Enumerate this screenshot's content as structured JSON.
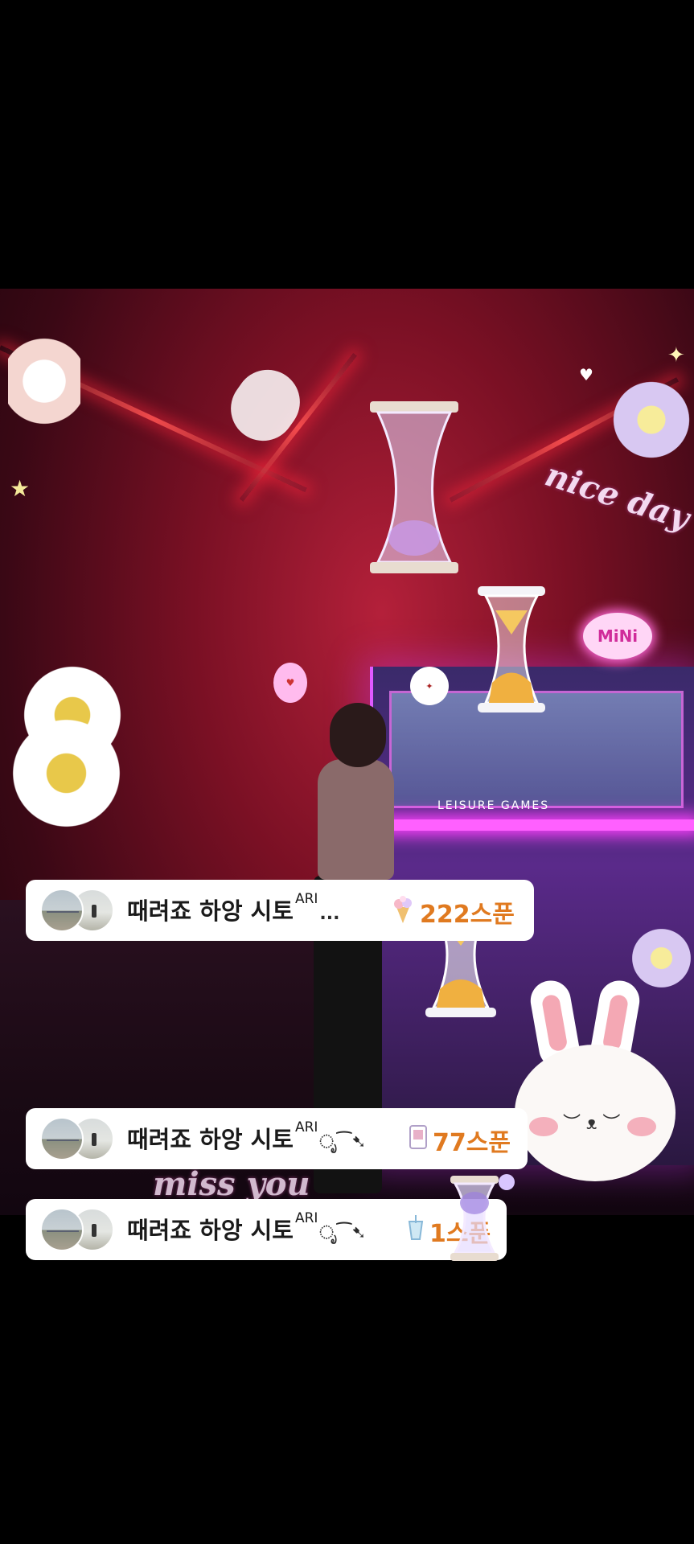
{
  "stream": {
    "background_scene": "arcade claw machines",
    "stickers": {
      "nice_day_text": "nice day",
      "miss_you_text": "miss you",
      "mini_sign": "MiNi",
      "leisure_games_label": "LEISURE GAMES"
    }
  },
  "donations": [
    {
      "username": "때려죠 하앙 시토",
      "superscript": "ARI",
      "suffix": "...",
      "gift_icon": "flower-bouquet-icon",
      "amount": "222스푼"
    },
    {
      "username": "때려죠 하앙 시토",
      "superscript": "ARI",
      "suffix": "ೃ⁀➷",
      "gift_icon": "photo-card-icon",
      "amount": "77스푼"
    },
    {
      "username": "때려죠 하앙 시토",
      "superscript": "ARI",
      "suffix": "ೃ⁀➷",
      "gift_icon": "drink-cup-icon",
      "amount": "1스푼"
    }
  ],
  "colors": {
    "amount_text": "#e07a20",
    "card_bg": "#ffffff",
    "screen_bg": "#000000"
  }
}
